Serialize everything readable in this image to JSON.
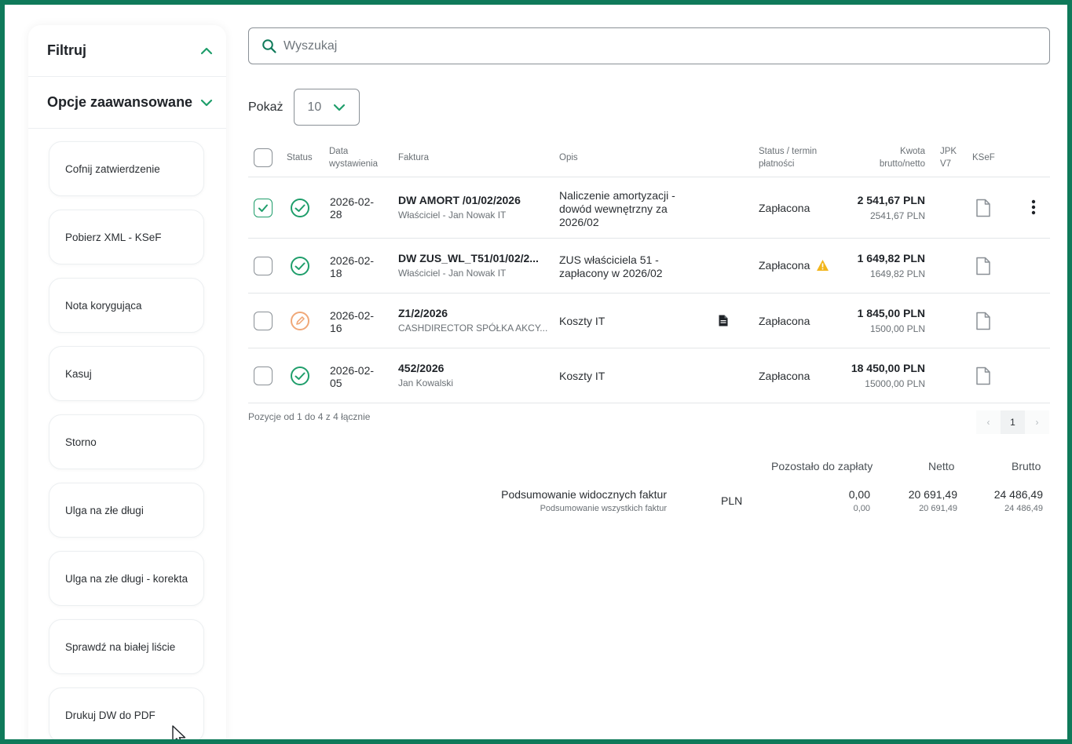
{
  "sidebar": {
    "filter_label": "Filtruj",
    "advanced_label": "Opcje zaawansowane",
    "buttons": [
      "Cofnij zatwierdzenie",
      "Pobierz XML - KSeF",
      "Nota korygująca",
      "Kasuj",
      "Storno",
      "Ulga na złe długi",
      "Ulga na złe długi - korekta",
      "Sprawdź na białej liście",
      "Drukuj DW do PDF"
    ]
  },
  "search": {
    "placeholder": "Wyszukaj"
  },
  "pagination_size": {
    "label": "Pokaż",
    "value": "10"
  },
  "table": {
    "headers": {
      "status": "Status",
      "date_1": "Data",
      "date_2": "wystawienia",
      "invoice": "Faktura",
      "desc": "Opis",
      "status_due_1": "Status / termin",
      "status_due_2": "płatności",
      "amount_1": "Kwota",
      "amount_2": "brutto/netto",
      "jpk_1": "JPK",
      "jpk_2": "V7",
      "ksef": "KSeF"
    },
    "rows": [
      {
        "checked": true,
        "status_icon": "check-circle",
        "date_1": "2026-02-",
        "date_2": "28",
        "invoice": "DW AMORT /01/02/2026",
        "party": "Właściciel - Jan Nowak IT",
        "desc_1": "Naliczenie amortyzacji -",
        "desc_2": "dowód wewnętrzny za",
        "desc_3": "2026/02",
        "payment": "Zapłacona",
        "gross": "2 541,67 PLN",
        "net": "2541,67 PLN"
      },
      {
        "checked": false,
        "status_icon": "check-circle",
        "date_1": "2026-02-",
        "date_2": "18",
        "invoice": "DW ZUS_WL_T51/01/02/2...",
        "party": "Właściciel - Jan Nowak IT",
        "desc_1": "ZUS właściciela 51 -",
        "desc_2": "zapłacony w 2026/02",
        "desc_3": "",
        "payment": "Zapłacona",
        "gross": "1 649,82 PLN",
        "net": "1649,82 PLN"
      },
      {
        "checked": false,
        "status_icon": "edit-circle",
        "date_1": "2026-02-",
        "date_2": "16",
        "invoice": "Z1/2/2026",
        "party": "CASHDIRECTOR SPÓŁKA AKCY...",
        "desc_1": "Koszty IT",
        "desc_2": "",
        "desc_3": "",
        "payment": "Zapłacona",
        "gross": "1 845,00 PLN",
        "net": "1500,00 PLN"
      },
      {
        "checked": false,
        "status_icon": "check-circle",
        "date_1": "2026-02-",
        "date_2": "05",
        "invoice": "452/2026",
        "party": "Jan Kowalski",
        "desc_1": "Koszty IT",
        "desc_2": "",
        "desc_3": "",
        "payment": "Zapłacona",
        "gross": "18 450,00 PLN",
        "net": "15000,00 PLN"
      }
    ]
  },
  "info": "Pozycje od 1 do 4 z 4 łącznie",
  "pager": {
    "prev": "‹",
    "page": "1",
    "next": "›"
  },
  "summary": {
    "remaining_label": "Pozostało do zapłaty",
    "net_label": "Netto",
    "gross_label": "Brutto",
    "visible_label": "Podsumowanie widocznych faktur",
    "all_label": "Podsumowanie wszystkich faktur",
    "currency": "PLN",
    "visible_remaining": "0,00",
    "visible_net": "20 691,49",
    "visible_gross": "24 486,49",
    "all_remaining": "0,00",
    "all_net": "20 691,49",
    "all_gross": "24 486,49"
  },
  "colors": {
    "frame": "#0f7a5a",
    "accent": "#1f9e6b",
    "warning": "#f2b51c",
    "pending": "#f0a878"
  }
}
